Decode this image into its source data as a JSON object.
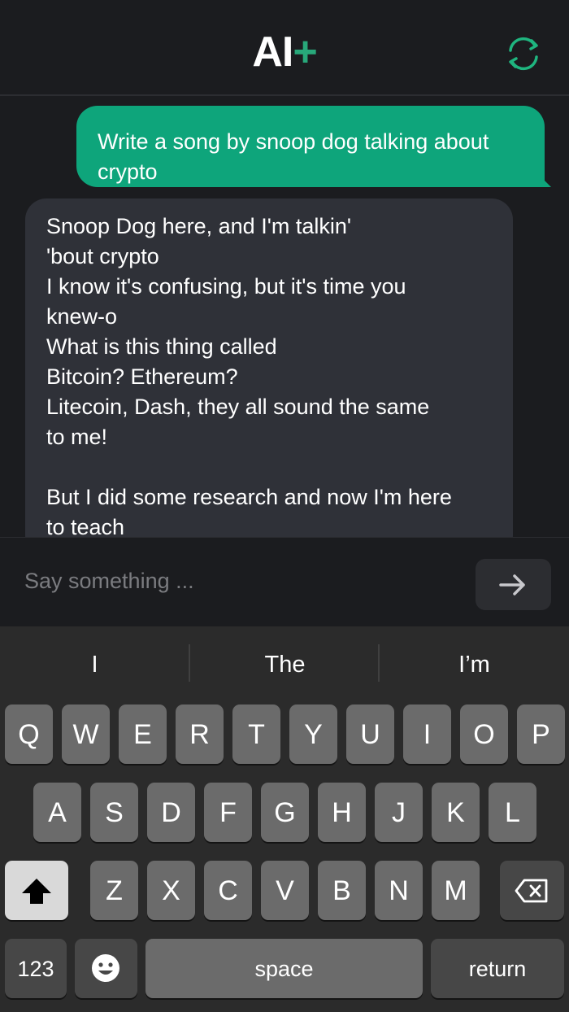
{
  "header": {
    "logo_main": "AI",
    "logo_accent": "+",
    "refresh_icon": "refresh-icon"
  },
  "chat": {
    "user_message": "Write a song by snoop dog talking about crypto",
    "bot_lines": [
      "Snoop Dog here, and I'm talkin'",
      "'bout crypto",
      "I know it's confusing, but it's time you",
      "knew-o",
      "What is this thing called",
      "Bitcoin? Ethereum?",
      "Litecoin, Dash, they all sound the same",
      "to me!",
      "",
      "But I did some research and now I'm here",
      "to teach"
    ]
  },
  "input": {
    "placeholder": "Say something ...",
    "send_icon": "arrow-right-icon"
  },
  "keyboard": {
    "suggestions": [
      "I",
      "The",
      "I’m"
    ],
    "row1": [
      "Q",
      "W",
      "E",
      "R",
      "T",
      "Y",
      "U",
      "I",
      "O",
      "P"
    ],
    "row2": [
      "A",
      "S",
      "D",
      "F",
      "G",
      "H",
      "J",
      "K",
      "L"
    ],
    "row3": [
      "Z",
      "X",
      "C",
      "V",
      "B",
      "N",
      "M"
    ],
    "numbers_label": "123",
    "space_label": "space",
    "return_label": "return",
    "shift_icon": "shift-icon",
    "delete_icon": "backspace-icon",
    "emoji_icon": "emoji-icon"
  },
  "colors": {
    "accent": "#0ea57b",
    "logo_accent": "#28a87a",
    "bot_bubble": "#2f3138",
    "background": "#1b1c1f"
  }
}
